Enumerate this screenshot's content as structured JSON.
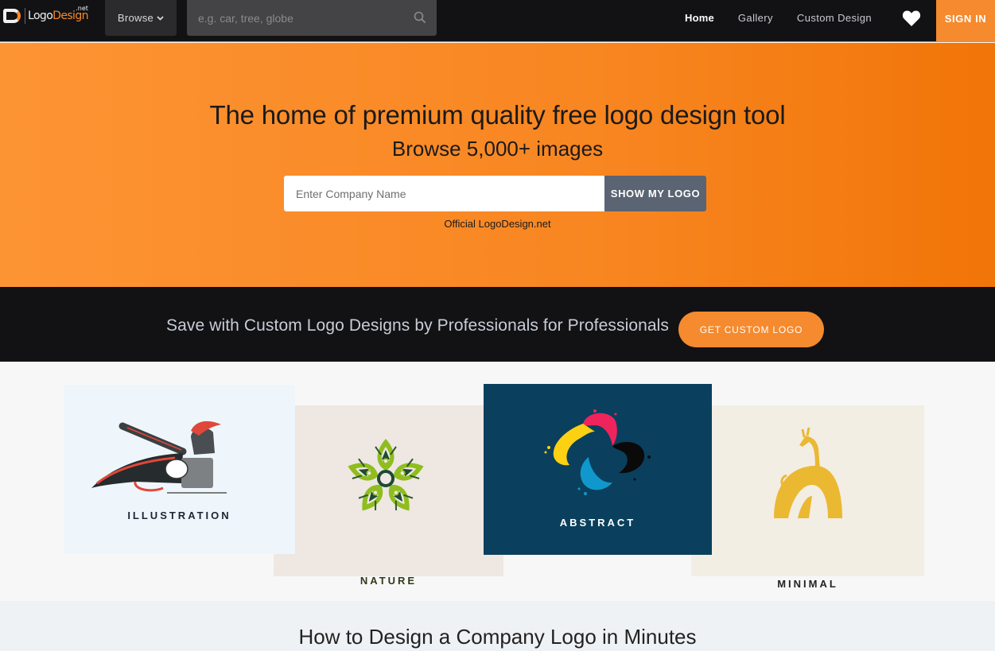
{
  "navbar": {
    "logo": {
      "text_main": "Logo",
      "text_accent": "Design",
      "tld": ".net"
    },
    "browse_label": "Browse",
    "search": {
      "placeholder": "e.g. car, tree, globe",
      "value": ""
    },
    "links": [
      {
        "label": "Home",
        "active": true
      },
      {
        "label": "Gallery",
        "active": false
      },
      {
        "label": "Custom Design",
        "active": false
      }
    ],
    "favorites_icon": "heart-icon",
    "signin_label": "SIGN IN"
  },
  "hero": {
    "title": "The home of premium quality free logo design tool",
    "subtitle": "Browse 5,000+ images",
    "company_input": {
      "placeholder": "Enter Company Name",
      "value": ""
    },
    "submit_label": "SHOW MY LOGO",
    "note": "Official LogoDesign.net"
  },
  "cta": {
    "text": "Save with Custom Logo Designs by Professionals for Professionals",
    "button_label": "GET CUSTOM LOGO"
  },
  "categories": [
    {
      "label": "ILLUSTRATION",
      "art": "knight-baseball-illustration"
    },
    {
      "label": "NATURE",
      "art": "green-leaf-mandala"
    },
    {
      "label": "ABSTRACT",
      "art": "cmyk-paint-splash-swirl"
    },
    {
      "label": "MINIMAL",
      "art": "yellow-giraffe-arch"
    }
  ],
  "howto": {
    "title": "How to Design a Company Logo in Minutes"
  },
  "colors": {
    "brand_orange": "#f58a2e",
    "nav_bg": "#121214",
    "button_slate": "#5a6472",
    "abstract_bg": "#0a405d"
  }
}
